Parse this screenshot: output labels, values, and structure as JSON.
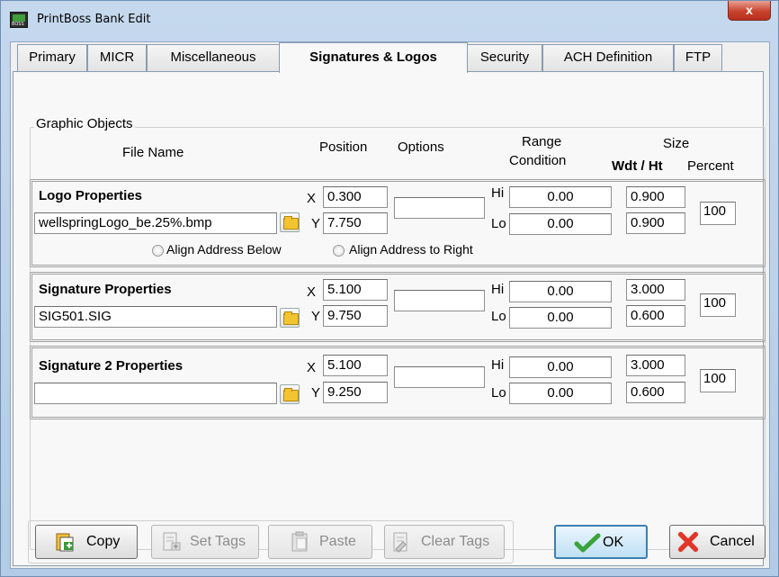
{
  "window": {
    "title": "PrintBoss Bank Edit",
    "close_glyph": "x",
    "app_icon_text": "BOSS"
  },
  "tabs": [
    {
      "label": "Primary",
      "active": false
    },
    {
      "label": "MICR",
      "active": false
    },
    {
      "label": "Miscellaneous",
      "active": false
    },
    {
      "label": "Signatures & Logos",
      "active": true
    },
    {
      "label": "Security",
      "active": false
    },
    {
      "label": "ACH Definition",
      "active": false
    },
    {
      "label": "FTP",
      "active": false
    }
  ],
  "graphic_objects": {
    "title": "Graphic Objects",
    "headers": {
      "file_name": "File Name",
      "position": "Position",
      "options": "Options",
      "range": "Range",
      "condition": "Condition",
      "size": "Size",
      "wdt_ht": "Wdt / Ht",
      "percent": "Percent"
    },
    "axis": {
      "x": "X",
      "y": "Y",
      "hi": "Hi",
      "lo": "Lo"
    },
    "logo": {
      "title": "Logo Properties",
      "file": "wellspringLogo_be.25%.bmp",
      "x": "0.300",
      "y": "7.750",
      "options": "",
      "hi": "0.00",
      "lo": "0.00",
      "wdt": "0.900",
      "ht": "0.900",
      "percent": "100",
      "align_below": "Align Address Below",
      "align_right": "Align Address to Right"
    },
    "signature": {
      "title": "Signature Properties",
      "file": "SIG501.SIG",
      "x": "5.100",
      "y": "9.750",
      "options": "",
      "hi": "0.00",
      "lo": "0.00",
      "wdt": "3.000",
      "ht": "0.600",
      "percent": "100"
    },
    "signature2": {
      "title": "Signature 2 Properties",
      "file": "",
      "x": "5.100",
      "y": "9.250",
      "options": "",
      "hi": "0.00",
      "lo": "0.00",
      "wdt": "3.000",
      "ht": "0.600",
      "percent": "100"
    }
  },
  "buttons": {
    "copy": "Copy",
    "set_tags": "Set Tags",
    "paste": "Paste",
    "clear_tags": "Clear Tags",
    "ok": "OK",
    "cancel": "Cancel"
  },
  "icons": {
    "folder": "folder-icon",
    "copy": "copy-icon",
    "set_tags": "set-tags-icon",
    "paste": "paste-icon",
    "clear_tags": "clear-tags-icon",
    "ok": "checkmark-icon",
    "cancel": "red-x-icon"
  },
  "colors": {
    "ok_check": "#3aa33a",
    "cancel_x": "#e0372a",
    "close_button": "#c7432e"
  }
}
